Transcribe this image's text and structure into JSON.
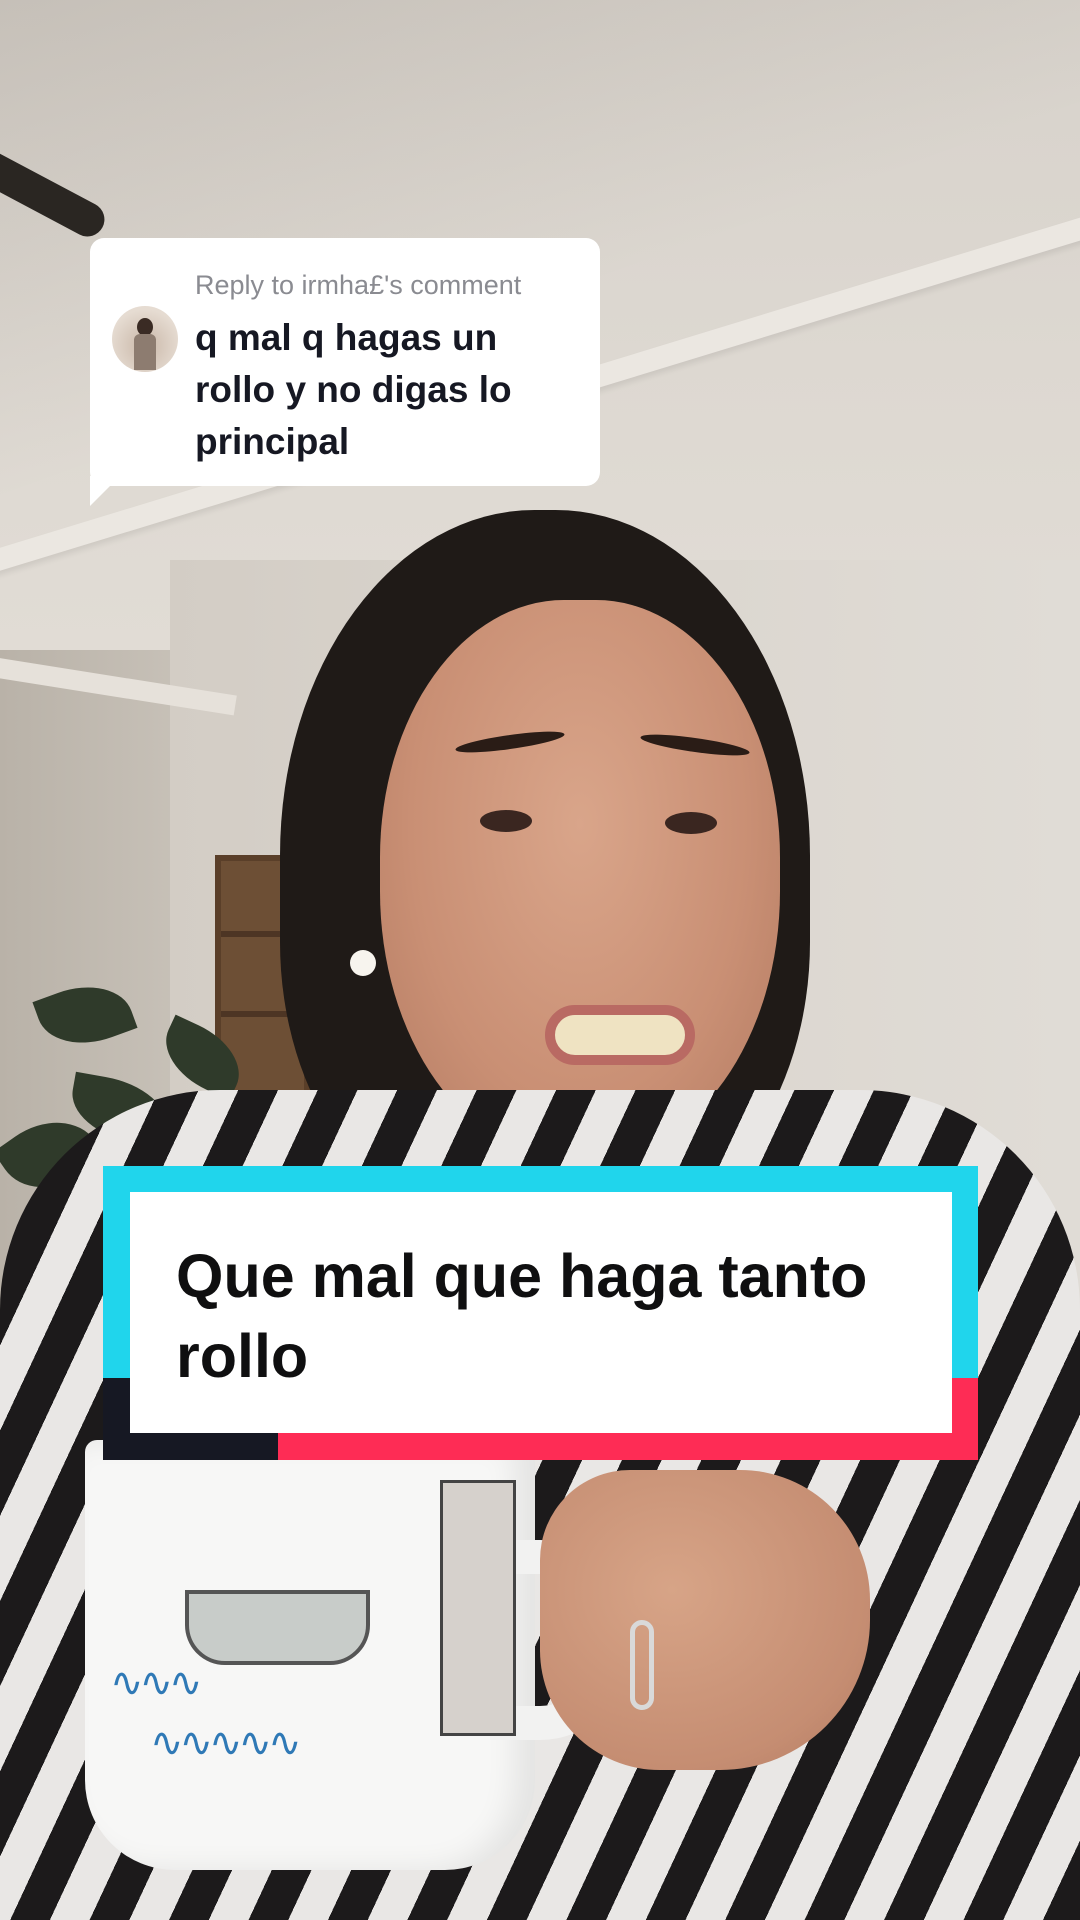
{
  "reply_comment": {
    "header": "Reply to irmha£'s comment",
    "text": "q mal q hagas un rollo y no digas lo principal",
    "avatar_icon": "user-avatar-photo"
  },
  "caption": {
    "text": "Que mal que haga tanto rollo"
  },
  "colors": {
    "caption_cyan": "#20d5ec",
    "caption_red": "#fe2c55",
    "caption_dark": "#161823",
    "bubble_bg": "#ffffff",
    "header_gray": "#8a8b91"
  }
}
